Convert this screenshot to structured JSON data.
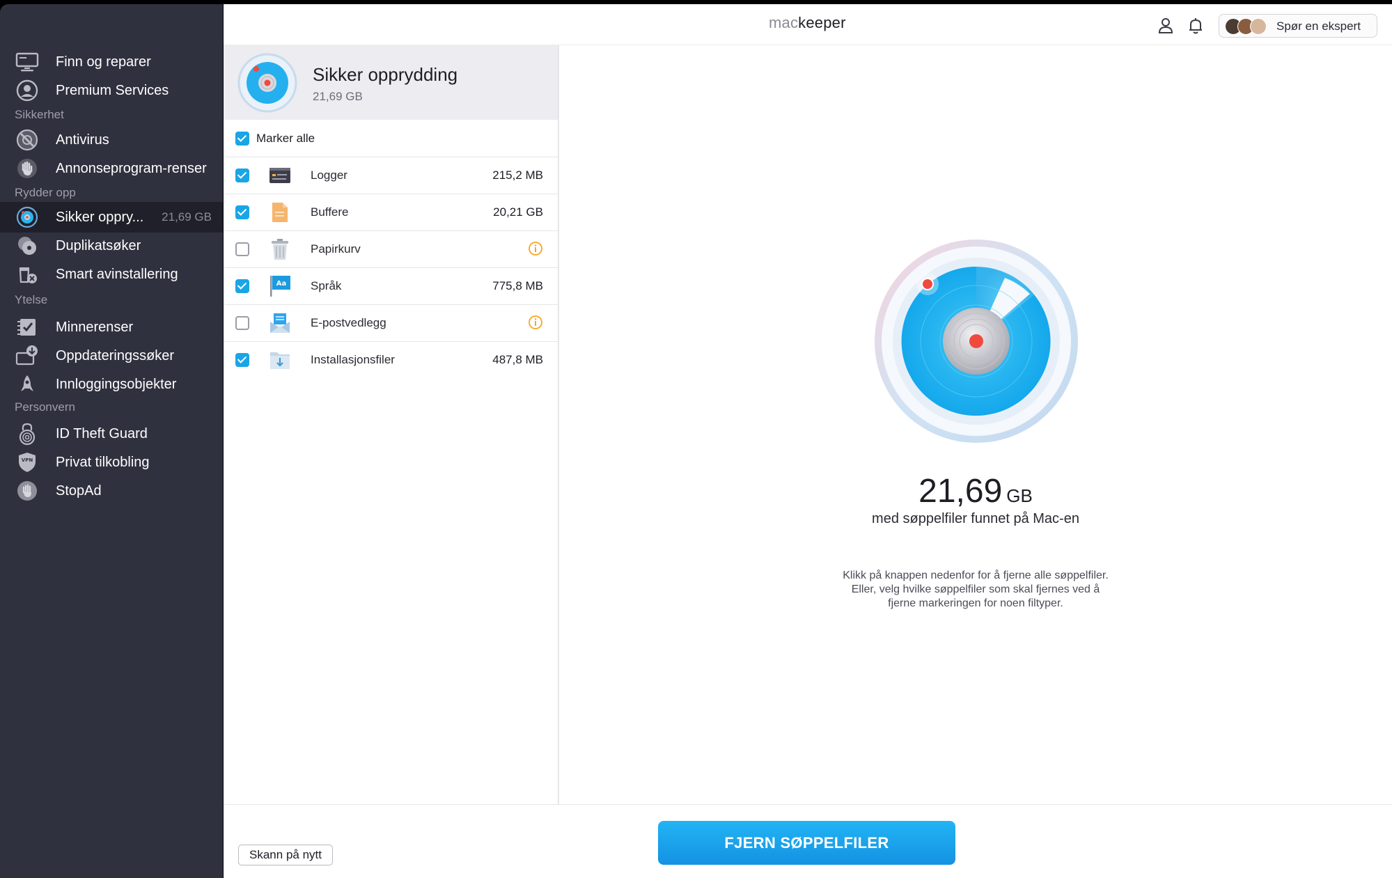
{
  "app": {
    "logo_part1": "mac",
    "logo_part2": "keeper"
  },
  "sidebar": {
    "items": [
      {
        "label": "Finn og reparer",
        "icon": "monitor-icon"
      },
      {
        "label": "Premium Services",
        "icon": "support-agent-icon"
      },
      {
        "label": "Antivirus",
        "icon": "antivirus-icon"
      },
      {
        "label": "Annonseprogram-renser",
        "icon": "hand-stop-icon"
      },
      {
        "label": "Sikker oppry...",
        "size": "21,69 GB",
        "icon": "radar-icon"
      },
      {
        "label": "Duplikatsøker",
        "icon": "duplicate-discs-icon"
      },
      {
        "label": "Smart avinstallering",
        "icon": "uninstall-trash-icon"
      },
      {
        "label": "Minnerenser",
        "icon": "memory-check-icon"
      },
      {
        "label": "Oppdateringssøker",
        "icon": "update-download-icon"
      },
      {
        "label": "Innloggingsobjekter",
        "icon": "rocket-icon"
      },
      {
        "label": "ID Theft Guard",
        "icon": "fingerprint-lock-icon"
      },
      {
        "label": "Privat tilkobling",
        "icon": "vpn-shield-icon"
      },
      {
        "label": "StopAd",
        "icon": "stopad-hand-icon"
      }
    ],
    "sections": {
      "security": "Sikkerhet",
      "cleanup": "Rydder opp",
      "performance": "Ytelse",
      "privacy": "Personvern"
    }
  },
  "topbar": {
    "expert_label": "Spør en ekspert"
  },
  "list": {
    "title": "Sikker opprydding",
    "total": "21,69 GB",
    "select_all": "Marker alle",
    "rows": [
      {
        "label": "Logger",
        "size": "215,2 MB",
        "checked": true,
        "icon": "log-file-icon"
      },
      {
        "label": "Buffere",
        "size": "20,21 GB",
        "checked": true,
        "icon": "cache-file-icon"
      },
      {
        "label": "Papirkurv",
        "size": "",
        "checked": false,
        "icon": "trash-bin-icon"
      },
      {
        "label": "Språk",
        "size": "775,8 MB",
        "checked": true,
        "icon": "language-flag-icon"
      },
      {
        "label": "E-postvedlegg",
        "size": "",
        "checked": false,
        "icon": "mail-attachment-icon"
      },
      {
        "label": "Installasjonsfiler",
        "size": "487,8 MB",
        "checked": true,
        "icon": "installer-folder-icon"
      }
    ]
  },
  "detail": {
    "amount": "21,69",
    "unit": "GB",
    "found_text": "med søppelfiler funnet på Mac-en",
    "hint": "Klikk på knappen nedenfor for å fjerne alle søppelfiler. Eller, velg hvilke søppelfiler som skal fjernes ved å fjerne markeringen for noen filtyper."
  },
  "buttons": {
    "rescan": "Skann på nytt",
    "remove": "FJERN SØPPELFILER"
  },
  "colors": {
    "sidebar_bg": "#30313f",
    "sidebar_active": "#1f2029",
    "accent": "#1aa5e6",
    "warning": "#f5a623"
  }
}
